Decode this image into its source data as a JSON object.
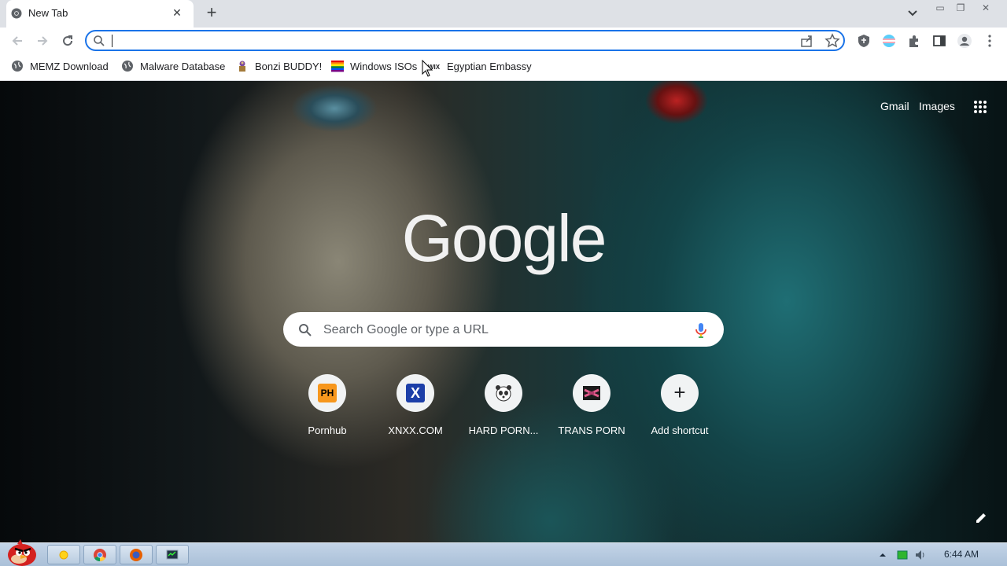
{
  "browser": {
    "tab": {
      "title": "New Tab",
      "close": "✕"
    },
    "new_tab": "+",
    "window_controls": {
      "minimize": "▭",
      "restore": "❐",
      "close": "✕"
    },
    "omnibox": {
      "value": ""
    }
  },
  "bookmarks": [
    {
      "label": "MEMZ Download",
      "icon": "globe-icon"
    },
    {
      "label": "Malware Database",
      "icon": "globe-icon"
    },
    {
      "label": "Bonzi BUDDY!",
      "icon": "bonzi-icon"
    },
    {
      "label": "Windows ISOs",
      "icon": "rainbow-flag-icon"
    },
    {
      "label": "Egyptian Embassy",
      "icon": "wix-icon"
    }
  ],
  "newtab": {
    "links": {
      "gmail": "Gmail",
      "images": "Images"
    },
    "logo": "Google",
    "search_placeholder": "Search Google or type a URL",
    "shortcuts": [
      {
        "label": "Pornhub",
        "icon_text": "PH"
      },
      {
        "label": "XNXX.COM",
        "icon_text": "X"
      },
      {
        "label": "HARD PORN...",
        "icon_text": ""
      },
      {
        "label": "TRANS PORN",
        "icon_text": ""
      },
      {
        "label": "Add shortcut",
        "icon_text": "+"
      }
    ]
  },
  "taskbar": {
    "clock": "6:44 AM"
  },
  "colors": {
    "accent": "#1a73e8",
    "tab_strip": "#dee1e6",
    "taskbar": "#b9cce0"
  }
}
